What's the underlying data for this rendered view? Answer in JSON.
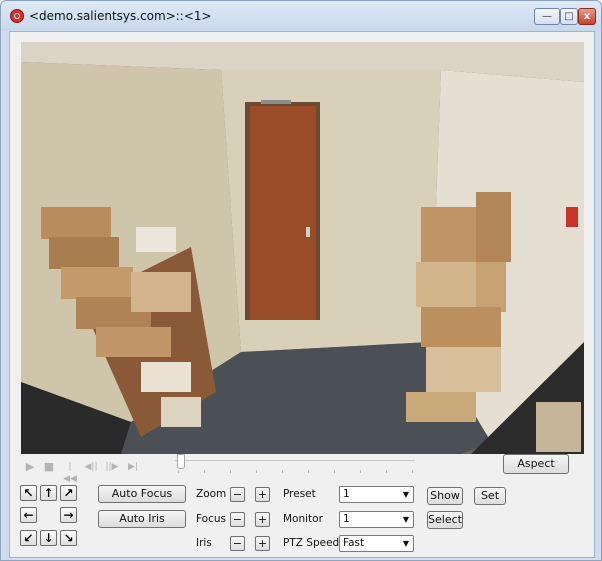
{
  "window": {
    "title": "<demo.salientsys.com>::<1>",
    "minimize_label": "—",
    "maximize_label": "□",
    "close_label": "x"
  },
  "playback": {
    "play": "▶",
    "stop": "■",
    "rewind_start": "|◀◀",
    "step_back": "◀||",
    "step_forward": "||▶",
    "forward_end": "▶|",
    "position": 0
  },
  "buttons": {
    "aspect": "Aspect",
    "auto_focus": "Auto Focus",
    "auto_iris": "Auto Iris",
    "show": "Show",
    "set": "Set",
    "select": "Select"
  },
  "ptz": {
    "up_left": "↖",
    "up": "↑",
    "up_right": "↗",
    "left": "←",
    "right": "→",
    "down_left": "↙",
    "down": "↓",
    "down_right": "↘"
  },
  "lens": {
    "zoom_label": "Zoom",
    "focus_label": "Focus",
    "iris_label": "Iris",
    "minus": "−",
    "plus": "+"
  },
  "settings": {
    "preset_label": "Preset",
    "preset_value": "1",
    "monitor_label": "Monitor",
    "monitor_value": "1",
    "speed_label": "PTZ Speed",
    "speed_value": "Fast"
  },
  "colors": {
    "title_bar": "#cfdced",
    "close_button": "#c4412b",
    "door": "#9a4c26"
  }
}
